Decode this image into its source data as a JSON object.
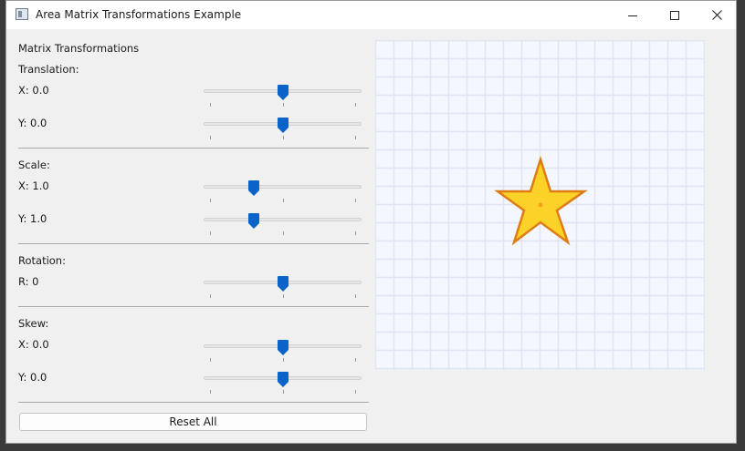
{
  "window": {
    "title": "Area Matrix Transformations Example"
  },
  "panel": {
    "heading": "Matrix Transformations",
    "translation": {
      "label": "Translation:",
      "x_label": "X: 0.0",
      "y_label": "Y: 0.0",
      "x_value": 0.5,
      "y_value": 0.5
    },
    "scale": {
      "label": "Scale:",
      "x_label": "X: 1.0",
      "y_label": "Y: 1.0",
      "x_value": 0.32,
      "y_value": 0.32
    },
    "rotation": {
      "label": "Rotation:",
      "r_label": "R: 0",
      "r_value": 0.5
    },
    "skew": {
      "label": "Skew:",
      "x_label": "X: 0.0",
      "y_label": "Y: 0.0",
      "x_value": 0.5,
      "y_value": 0.5
    },
    "reset_label": "Reset All"
  },
  "colors": {
    "accent": "#0a63c9",
    "grid": "#dfe6f3",
    "canvas_bg": "#f4f7fd",
    "star_fill": "#fcd229",
    "star_stroke": "#de7c16"
  },
  "icons": [
    "app-icon",
    "minimize-icon",
    "maximize-icon",
    "close-icon",
    "star-shape"
  ]
}
